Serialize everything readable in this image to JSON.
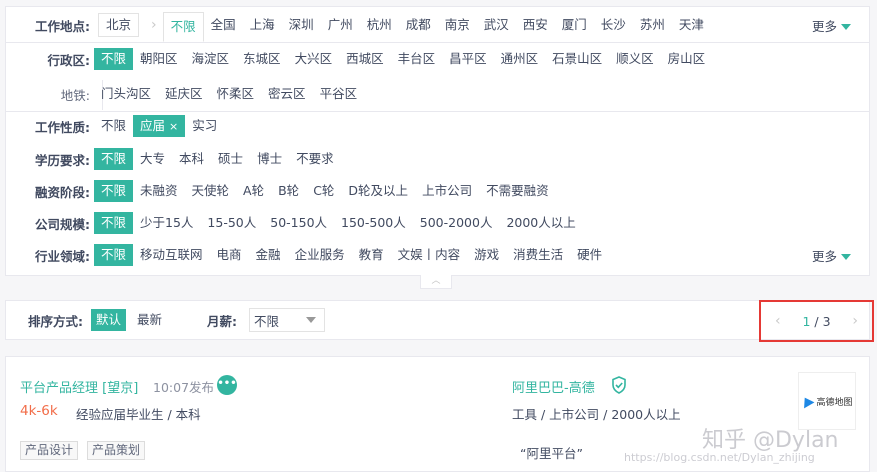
{
  "location": {
    "label": "工作地点:",
    "current_city": "北京",
    "unlimited": "不限",
    "cities": [
      "全国",
      "上海",
      "深圳",
      "广州",
      "杭州",
      "成都",
      "南京",
      "武汉",
      "西安",
      "厦门",
      "长沙",
      "苏州",
      "天津"
    ],
    "more": "更多"
  },
  "district": {
    "label": "行政区:",
    "selected": "不限",
    "items": [
      "朝阳区",
      "海淀区",
      "东城区",
      "大兴区",
      "西城区",
      "丰台区",
      "昌平区",
      "通州区",
      "石景山区",
      "顺义区",
      "房山区"
    ],
    "subway_label": "地铁:",
    "items2": [
      "门头沟区",
      "延庆区",
      "怀柔区",
      "密云区",
      "平谷区"
    ]
  },
  "filters": {
    "nature": {
      "label": "工作性质:",
      "items": [
        "不限",
        "应届",
        "实习"
      ],
      "selected": "应届",
      "remove": "×"
    },
    "education": {
      "label": "学历要求:",
      "items": [
        "不限",
        "大专",
        "本科",
        "硕士",
        "博士",
        "不要求"
      ],
      "selected": "不限"
    },
    "financing": {
      "label": "融资阶段:",
      "items": [
        "不限",
        "未融资",
        "天使轮",
        "A轮",
        "B轮",
        "C轮",
        "D轮及以上",
        "上市公司",
        "不需要融资"
      ],
      "selected": "不限"
    },
    "size": {
      "label": "公司规模:",
      "items": [
        "不限",
        "少于15人",
        "15-50人",
        "50-150人",
        "150-500人",
        "500-2000人",
        "2000人以上"
      ],
      "selected": "不限"
    },
    "industry": {
      "label": "行业领域:",
      "items": [
        "不限",
        "移动互联网",
        "电商",
        "金融",
        "企业服务",
        "教育",
        "文娱丨内容",
        "游戏",
        "消费生活",
        "硬件"
      ],
      "selected": "不限",
      "more": "更多"
    }
  },
  "sort": {
    "label": "排序方式:",
    "options": [
      "默认",
      "最新"
    ],
    "selected": "默认",
    "salary_label": "月薪:",
    "salary_value": "不限"
  },
  "pager": {
    "current": "1",
    "sep": " / ",
    "total": "3",
    "prev": "‹",
    "next": "›"
  },
  "job": {
    "title": "平台产品经理 [望京]",
    "time": "10:07发布",
    "chat_glyph": "•••",
    "salary": "4k-6k",
    "requirements": "经验应届毕业生 / 本科",
    "tags": [
      "产品设计",
      "产品策划"
    ],
    "company": "阿里巴巴-高德",
    "company_info": "工具 / 上市公司 / 2000人以上",
    "benefit": "“阿里平台”",
    "logo_text": "高德地图"
  },
  "watermark": {
    "main": "知乎 @Dylan",
    "sub": "https://blog.csdn.net/Dylan_zhijing"
  },
  "colors": {
    "accent": "#33b5a0",
    "salary": "#f26d49",
    "highlight_border": "#e53935"
  }
}
